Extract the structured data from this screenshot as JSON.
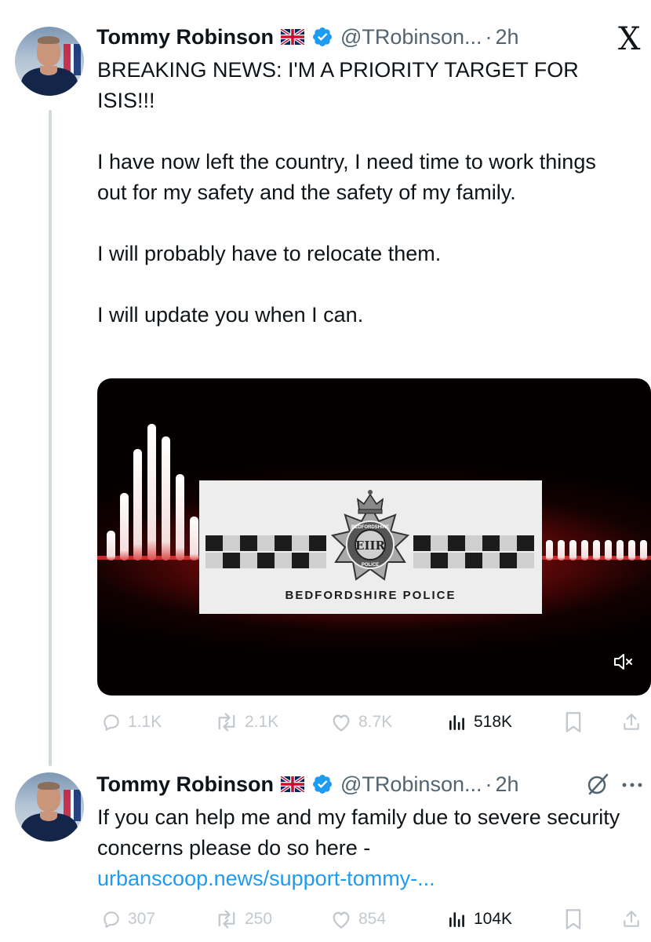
{
  "tweets": [
    {
      "author": {
        "name": "Tommy Robinson",
        "handle": "@TRobinson...",
        "time": "2h",
        "verified": true
      },
      "text": [
        "BREAKING NEWS: I'M A PRIORITY TARGET FOR ISIS!!!",
        "I have now left the country, I need time to work things out for my safety and the safety of my family.",
        "I will probably have to relocate them.",
        "I will update you when I can."
      ],
      "media": {
        "logo_text": "BEDFORDSHIRE POLICE",
        "badge_text": "BEDFORDSHIRE",
        "badge_lower": "POLICE",
        "badge_monogram": "EIIR"
      },
      "stats": {
        "replies": "1.1K",
        "reposts": "2.1K",
        "likes": "8.7K",
        "views": "518K"
      }
    },
    {
      "author": {
        "name": "Tommy Robinson",
        "handle": "@TRobinson...",
        "time": "2h",
        "verified": true
      },
      "text": "If you can help me and my family due to severe security concerns please do so here -",
      "link": "urbanscoop.news/support-tommy-...",
      "stats": {
        "replies": "307",
        "reposts": "250",
        "likes": "854",
        "views": "104K"
      }
    }
  ],
  "app": {
    "logo": "X"
  },
  "icons": {
    "flag": "uk-flag-icon",
    "verified": "verified-badge-icon",
    "reply": "reply-icon",
    "repost": "repost-icon",
    "like": "heart-icon",
    "views": "views-icon",
    "bookmark": "bookmark-icon",
    "share": "share-icon",
    "mute": "mute-icon",
    "grok": "grok-icon",
    "more": "more-icon"
  },
  "colors": {
    "verified": "#1d9bf0",
    "link": "#1d9bf0",
    "muted_text": "#536471",
    "thread_line": "#cfd9de"
  }
}
